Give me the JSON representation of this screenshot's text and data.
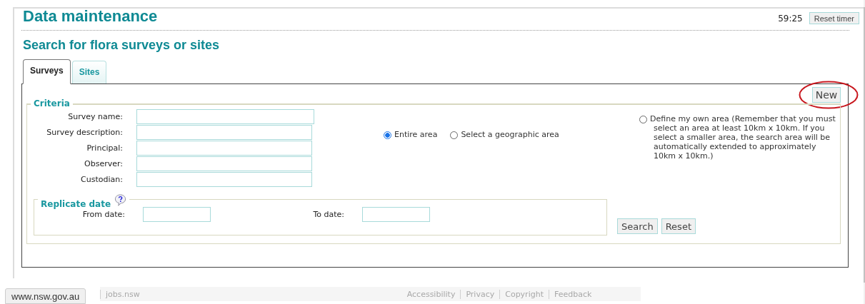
{
  "header": {
    "title": "Data maintenance",
    "timer": "59:25",
    "reset_timer_button": "Reset timer"
  },
  "subtitle": "Search for flora surveys or sites",
  "tabs": [
    {
      "label": "Surveys",
      "selected": true
    },
    {
      "label": "Sites",
      "selected": false
    }
  ],
  "new_button": "New",
  "criteria": {
    "legend": "Criteria",
    "fields": [
      {
        "label": "Survey name:"
      },
      {
        "label": "Survey description:"
      },
      {
        "label": "Principal:"
      },
      {
        "label": "Observer:"
      },
      {
        "label": "Custodian:"
      }
    ],
    "area_options": [
      {
        "label": "Entire area",
        "selected": true
      },
      {
        "label": "Select a geographic area",
        "selected": false
      },
      {
        "label": "Define my own area (Remember that you must select an area at least 10km x 10km. If you select a smaller area, the search area will be automatically extended to approximately 10km x 10km.)",
        "selected": false
      }
    ],
    "replicate_date": {
      "legend": "Replicate date",
      "from_label": "From date:",
      "to_label": "To date:"
    },
    "buttons": [
      "Search",
      "Reset"
    ]
  },
  "footer": {
    "links": [
      "jobs.nsw",
      "Accessibility",
      "Privacy",
      "Copyright",
      "Feedback"
    ]
  },
  "status_bar": {
    "url": "www.nsw.gov.au"
  }
}
